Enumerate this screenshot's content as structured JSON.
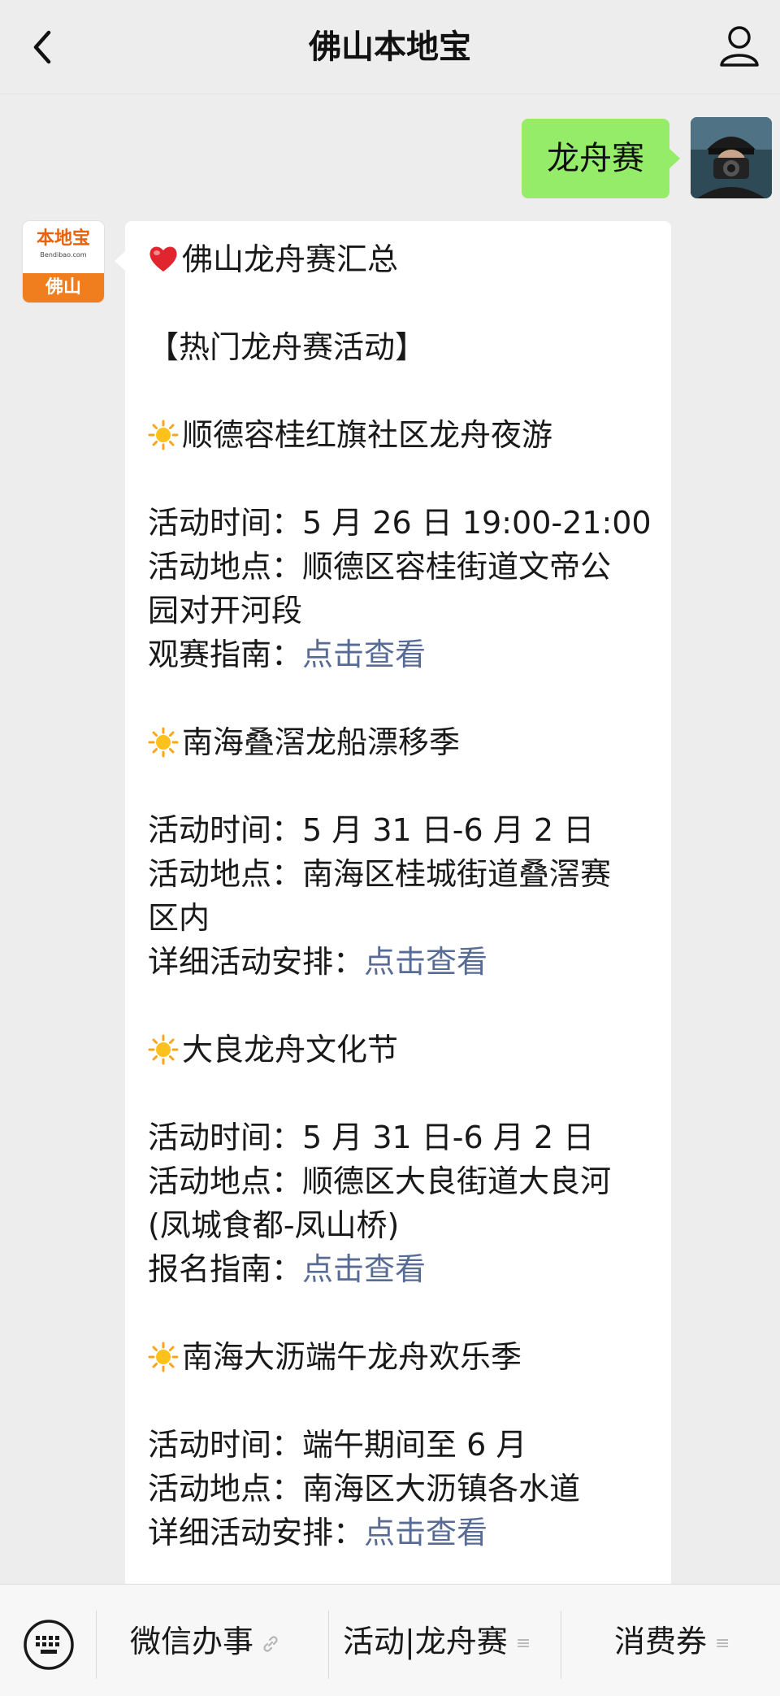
{
  "header": {
    "title": "佛山本地宝",
    "back_icon": "chevron-left-icon",
    "profile_icon": "person-icon"
  },
  "chat": {
    "outgoing": {
      "text": "龙舟赛"
    },
    "bot_avatar": {
      "logo_text": "本地宝",
      "logo_url": "Bendibao.com",
      "city": "佛山"
    },
    "incoming": {
      "title": "佛山龙舟赛汇总",
      "section_header": "【热门龙舟赛活动】",
      "events": [
        {
          "name": "顺德容桂红旗社区龙舟夜游",
          "time_label": "活动时间：",
          "time": "5 月 26 日 19:00-21:00",
          "place_label": "活动地点：",
          "place_line1": "顺德区容桂街道文帝公",
          "place_line2": "园对开河段",
          "guide_label": "观赛指南：",
          "link": "点击查看"
        },
        {
          "name": "南海叠滘龙船漂移季",
          "time_label": "活动时间：",
          "time": "5 月 31 日-6 月 2 日",
          "place_label": "活动地点：",
          "place_line1": "南海区桂城街道叠滘赛",
          "place_line2": "区内",
          "guide_label": "详细活动安排：",
          "link": "点击查看"
        },
        {
          "name": "大良龙舟文化节",
          "time_label": "活动时间：",
          "time": "5 月 31 日-6 月 2 日",
          "place_label": "活动地点：",
          "place_line1": "顺德区大良街道大良河",
          "place_line2": "(凤城食都-凤山桥)",
          "guide_label": "报名指南：",
          "link": "点击查看"
        },
        {
          "name": "南海大沥端午龙舟欢乐季",
          "time_label": "活动时间：",
          "time": "端午期间至 6 月",
          "place_label": "活动地点：",
          "place_line1": "南海区大沥镇各水道",
          "guide_label": "详细活动安排：",
          "link": "点击查看"
        }
      ]
    }
  },
  "menu": {
    "keyboard_icon": "keyboard-icon",
    "items": [
      {
        "label": "微信办事",
        "mark": "link-icon"
      },
      {
        "label": "活动|龙舟赛",
        "mark": "≡"
      },
      {
        "label": "消费券",
        "mark": "≡"
      }
    ]
  },
  "colors": {
    "background": "#ededed",
    "outgoing_bubble": "#95ec69",
    "incoming_bubble": "#ffffff",
    "link": "#576b95",
    "brand_orange": "#f07d1e"
  }
}
